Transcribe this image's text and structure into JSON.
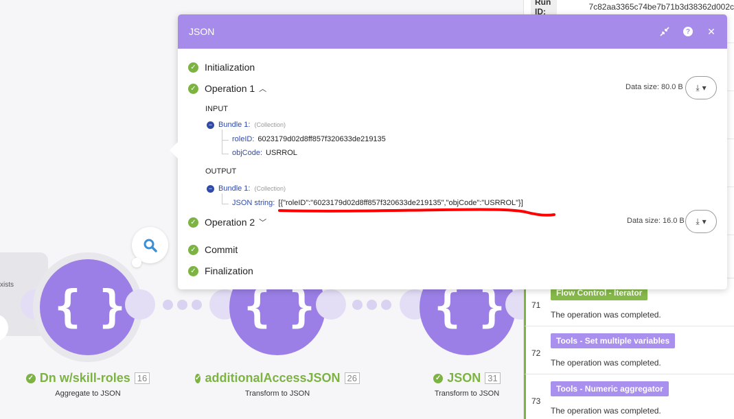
{
  "dialog": {
    "title": "JSON",
    "phases": {
      "initialization": "Initialization",
      "operation1": "Operation 1",
      "operation2": "Operation 2",
      "commit": "Commit",
      "finalization": "Finalization"
    },
    "operation1": {
      "data_size": "Data size: 80.0 B",
      "input_label": "INPUT",
      "output_label": "OUTPUT",
      "input_bundle": {
        "name": "Bundle 1:",
        "type": "(Collection)",
        "fields": [
          {
            "key": "roleID:",
            "value": "6023179d02d8ff857f320633de219135"
          },
          {
            "key": "objCode:",
            "value": "USRROL"
          }
        ]
      },
      "output_bundle": {
        "name": "Bundle 1:",
        "type": "(Collection)",
        "fields": [
          {
            "key": "JSON string:",
            "value": "[{\"roleID\":\"6023179d02d8ff857f320633de219135\",\"objCode\":\"USRROL\"}]"
          }
        ]
      }
    },
    "operation2": {
      "data_size": "Data size: 16.0 B"
    }
  },
  "canvas": {
    "left_stub_text": "xists",
    "modules": [
      {
        "name": "Dn w/skill-roles",
        "number": "16",
        "subtitle": "Aggregate to JSON"
      },
      {
        "name": "additionalAccessJSON",
        "number": "26",
        "subtitle": "Transform to JSON"
      },
      {
        "name": "JSON",
        "number": "31",
        "subtitle": "Transform to JSON"
      }
    ]
  },
  "right_panel": {
    "run_id_label": "Run ID:",
    "run_id_value": "7c82aa3365c74be7b71b3d38362d002c",
    "entries": [
      {
        "num": "71",
        "tag": "Flow Control - Iterator",
        "text": "The operation was completed."
      },
      {
        "num": "72",
        "tag": "Tools - Set multiple variables",
        "text": "The operation was completed."
      },
      {
        "num": "73",
        "tag": "Tools - Numeric aggregator",
        "text": "The operation was completed."
      }
    ]
  },
  "colors": {
    "accent": "#a78bea",
    "success": "#7cb342",
    "module": "#9b7fe6",
    "link": "#2f4aa8",
    "annotation": "#ff0000"
  },
  "icons": [
    "collapse-icon",
    "help-icon",
    "close-icon",
    "download-icon",
    "chevron-down-icon",
    "chevron-up-icon",
    "check-icon",
    "search-icon",
    "minus-icon"
  ]
}
